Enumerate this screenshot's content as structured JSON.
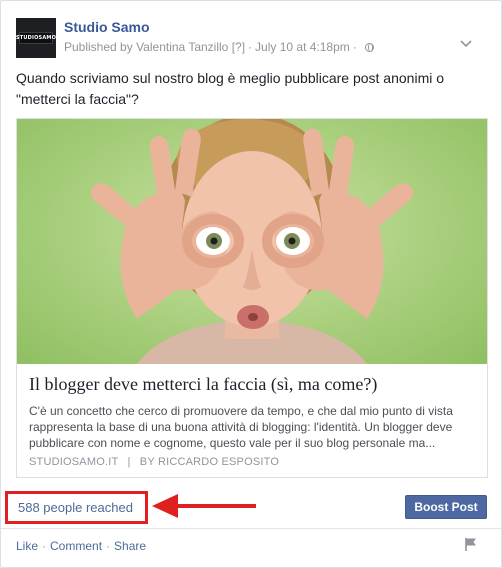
{
  "post": {
    "page_name": "Studio Samo",
    "logo_text": "STUDIOSAMO",
    "published_prefix": "Published by",
    "author": "Valentina Tanzillo",
    "help": "[?]",
    "timestamp": "July 10 at 4:18pm",
    "text": "Quando scriviamo sul nostro blog è meglio pubblicare post anonimi o \"metterci la faccia\"?",
    "privacy_icon": "globe-icon",
    "menu_icon": "chevron-down-icon"
  },
  "link_preview": {
    "title": "Il blogger deve metterci la faccia (sì, ma come?)",
    "description": "C'è un concetto che cerco di promuovere da tempo, e che dal mio punto di vista rappresenta la base di una buona attività di blogging: l'identità. Un blogger deve pubblicare con nome e cognome, questo vale per il suo blog personale ma...",
    "domain": "STUDIOSAMO.IT",
    "separator": "|",
    "by_prefix": "BY",
    "author": "RICCARDO ESPOSITO"
  },
  "insights": {
    "reach": "588 people reached",
    "boost_label": "Boost Post",
    "highlight_color": "#e02020"
  },
  "actions": {
    "like": "Like",
    "comment": "Comment",
    "share": "Share",
    "dot": "·"
  },
  "colors": {
    "link_blue": "#3b5998",
    "boost_blue": "#4e69a2",
    "photo_green": "#a9cf7d"
  }
}
